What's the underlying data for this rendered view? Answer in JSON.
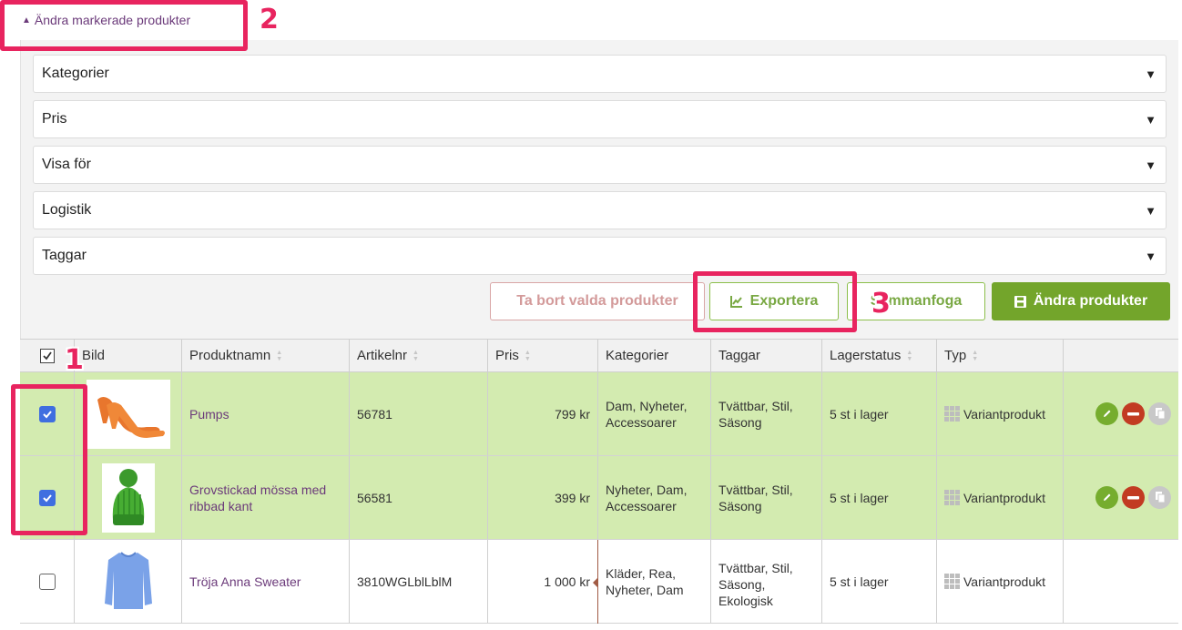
{
  "toggle": {
    "icon": "triangle-up-icon",
    "label": "Ändra markerade produkter"
  },
  "accordions": [
    {
      "label": "Kategorier",
      "icon": "triangle-down-icon"
    },
    {
      "label": "Pris",
      "icon": "triangle-down-icon"
    },
    {
      "label": "Visa för",
      "icon": "triangle-down-icon"
    },
    {
      "label": "Logistik",
      "icon": "triangle-down-icon"
    },
    {
      "label": "Taggar",
      "icon": "triangle-down-icon"
    }
  ],
  "actions": {
    "remove_label": "Ta bort valda produkter",
    "export_label": "Exportera",
    "export_icon": "chart-icon",
    "merge_label": "Sammanfoga",
    "change_label": "Ändra produkter",
    "change_icon": "save-icon"
  },
  "table": {
    "headers": {
      "image": "Bild",
      "name": "Produktnamn",
      "sku": "Artikelnr",
      "price": "Pris",
      "categories": "Kategorier",
      "tags": "Taggar",
      "stock": "Lagerstatus",
      "type": "Typ"
    },
    "rows": [
      {
        "selected": true,
        "image": "orange pumps",
        "name": "Pumps",
        "sku": "56781",
        "price": "799 kr",
        "categories": "Dam, Nyheter, Accessoarer",
        "tags": "Tvättbar, Stil, Säsong",
        "stock": "5 st i lager",
        "type": "Variantprodukt"
      },
      {
        "selected": true,
        "image": "green knitted hat",
        "name": "Grovstickad mössa med ribbad kant",
        "sku": "56581",
        "price": "399 kr",
        "categories": "Nyheter, Dam, Accessoarer",
        "tags": "Tvättbar, Stil, Säsong",
        "stock": "5 st i lager",
        "type": "Variantprodukt"
      },
      {
        "selected": false,
        "image": "blue sweater",
        "name": "Tröja Anna Sweater",
        "sku": "3810WGLblLblM",
        "price": "1 000 kr",
        "categories": "Kläder, Rea, Nyheter, Dam",
        "tags": "Tvättbar, Stil, Säsong, Ekologisk",
        "stock": "5 st i lager",
        "type": "Variantprodukt"
      }
    ]
  },
  "annotations": [
    "1",
    "2",
    "3"
  ],
  "colors": {
    "accent_green": "#73a52b",
    "link_purple": "#6b3a7a",
    "selected_row": "#d3ebb0",
    "annotation": "#e8245f",
    "delete_red": "#c23b22"
  }
}
